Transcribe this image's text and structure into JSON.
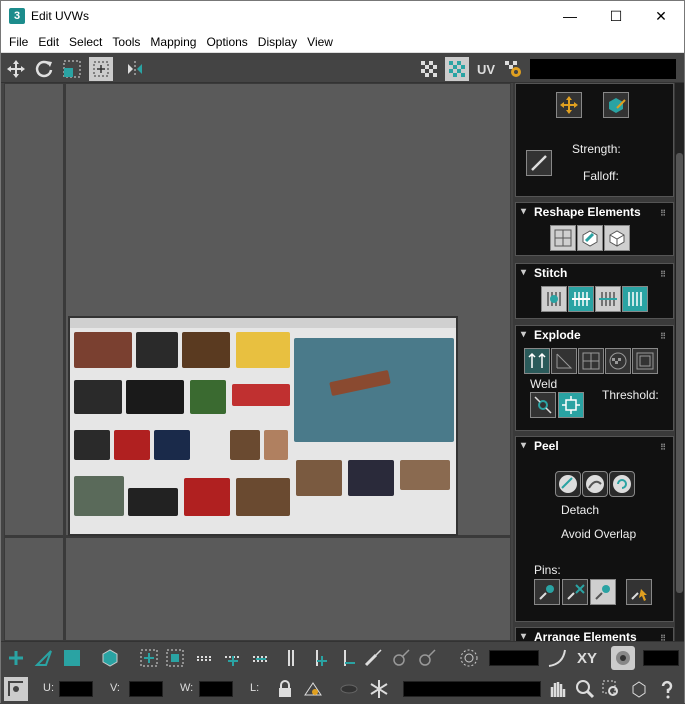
{
  "window": {
    "title": "Edit UVWs",
    "app_icon": "3",
    "min": "—",
    "max": "☐",
    "close": "✕"
  },
  "menu": [
    "File",
    "Edit",
    "Select",
    "Tools",
    "Mapping",
    "Options",
    "Display",
    "View"
  ],
  "toolbar": {
    "uv_label": "UV"
  },
  "paint": {
    "strength_label": "Strength:",
    "falloff_label": "Falloff:"
  },
  "rollouts": {
    "reshape": {
      "title": "Reshape Elements"
    },
    "stitch": {
      "title": "Stitch"
    },
    "explode": {
      "title": "Explode",
      "weld_label": "Weld",
      "threshold_label": "Threshold:"
    },
    "peel": {
      "title": "Peel",
      "detach_label": "Detach",
      "avoid_overlap_label": "Avoid Overlap",
      "pins_label": "Pins:"
    },
    "arrange": {
      "title": "Arrange Elements"
    }
  },
  "status": {
    "xy_label": "XY",
    "u_label": "U:",
    "v_label": "V:",
    "w_label": "W:",
    "l_label": "L:"
  },
  "colors": {
    "accent": "#2aa3a3",
    "panel_bg": "#111111",
    "viewport_bg": "#5a5a5a"
  }
}
